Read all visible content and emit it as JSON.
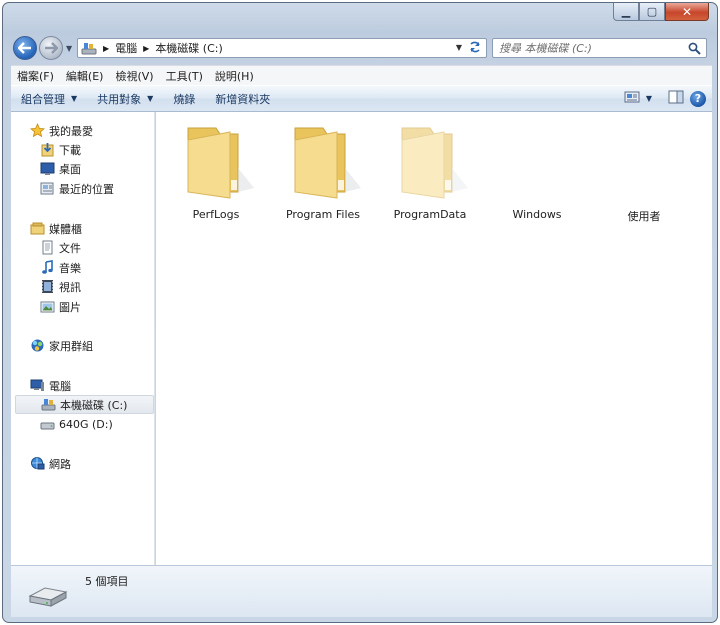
{
  "window": {
    "caption_buttons": {
      "minimize": "▁",
      "maximize": "▢",
      "close": "✕"
    }
  },
  "address": {
    "crumbs": [
      "電腦",
      "本機磁碟 (C:)"
    ]
  },
  "search": {
    "placeholder": "搜尋 本機磁碟 (C:)"
  },
  "menu": [
    "檔案(F)",
    "編輯(E)",
    "檢視(V)",
    "工具(T)",
    "說明(H)"
  ],
  "commands": {
    "organize": "組合管理",
    "share": "共用對象",
    "burn": "燒錄",
    "new_folder": "新增資料夾"
  },
  "sidebar": {
    "favorites": {
      "label": "我的最愛",
      "items": [
        "下載",
        "桌面",
        "最近的位置"
      ]
    },
    "libraries": {
      "label": "媒體櫃",
      "items": [
        "文件",
        "音樂",
        "視訊",
        "圖片"
      ]
    },
    "homegroup": {
      "label": "家用群組"
    },
    "computer": {
      "label": "電腦",
      "items": [
        "本機磁碟 (C:)",
        "640G (D:)"
      ]
    },
    "network": {
      "label": "網路"
    }
  },
  "files": [
    {
      "name": "PerfLogs",
      "icon": "folder-icon"
    },
    {
      "name": "Program Files",
      "icon": "folder-icon"
    },
    {
      "name": "ProgramData",
      "icon": "folder-icon"
    },
    {
      "name": "Windows",
      "icon": "folder-icon"
    },
    {
      "name": "使用者",
      "icon": "folder-icon"
    }
  ],
  "status": {
    "count": "5 個項目"
  },
  "colors": {
    "accent": "#2563b8",
    "folder": "#f3d88a",
    "close": "#c7462b"
  }
}
